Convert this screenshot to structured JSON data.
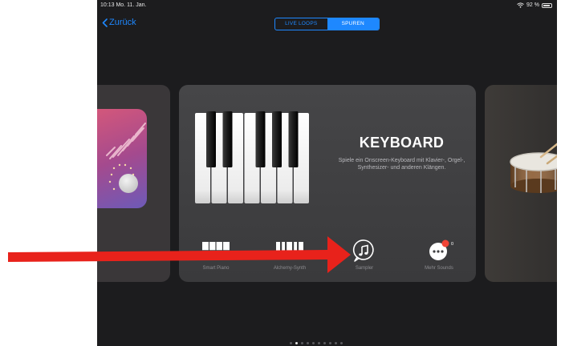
{
  "status_bar": {
    "time": "10:13  Mo. 11. Jan.",
    "battery": "92 %",
    "battery_level": 0.92
  },
  "nav": {
    "back_label": "Zurück"
  },
  "segmented": {
    "items": [
      "LIVE LOOPS",
      "SPUREN"
    ],
    "selected": "SPUREN"
  },
  "instrument": {
    "title": "KEYBOARD",
    "description": "Spiele ein Onscreen-Keyboard mit Klavier-, Orgel-, Synthesizer- und anderen Klängen.",
    "types": [
      {
        "label": "Smart Piano",
        "icon": "smart-piano-icon"
      },
      {
        "label": "Alchemy-Synth",
        "icon": "alchemy-synth-icon"
      },
      {
        "label": "Sampler",
        "icon": "sampler-icon"
      },
      {
        "label": "Mehr Sounds",
        "icon": "more-sounds-icon",
        "badge": "0"
      }
    ]
  },
  "annotation": {
    "arrow_color": "#e8221b"
  },
  "page_indicator": {
    "count": 10,
    "current": 1
  },
  "colors": {
    "accent": "#1e88ff",
    "background": "#1c1c1e",
    "card": "#434345"
  }
}
